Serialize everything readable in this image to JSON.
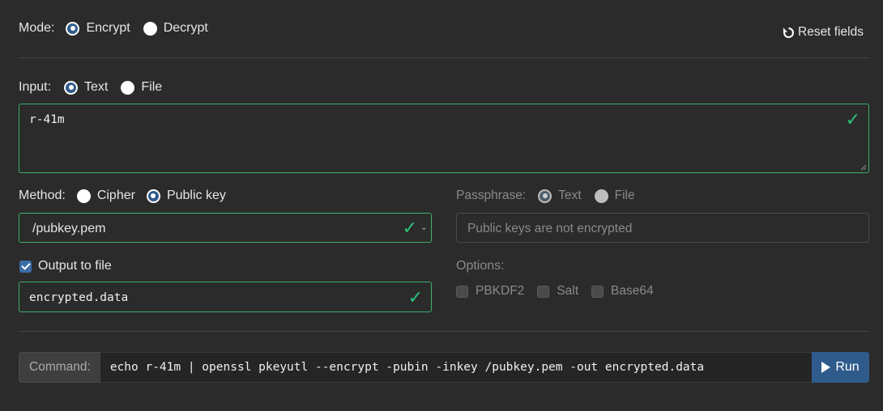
{
  "mode": {
    "label": "Mode:",
    "options": [
      "Encrypt",
      "Decrypt"
    ],
    "selected": "Encrypt"
  },
  "reset": {
    "label": "Reset fields",
    "icon": "reset-icon"
  },
  "input": {
    "label": "Input:",
    "options": [
      "Text",
      "File"
    ],
    "selected": "Text",
    "value": "r-41m"
  },
  "method": {
    "label": "Method:",
    "options": [
      "Cipher",
      "Public key"
    ],
    "selected": "Public key",
    "key_file": "/pubkey.pem"
  },
  "passphrase": {
    "label": "Passphrase:",
    "options": [
      "Text",
      "File"
    ],
    "selected": "Text",
    "placeholder": "Public keys are not encrypted"
  },
  "output": {
    "checkbox_label": "Output to file",
    "checked": true,
    "filename": "encrypted.data"
  },
  "options": {
    "label": "Options:",
    "items": [
      "PBKDF2",
      "Salt",
      "Base64"
    ]
  },
  "command": {
    "label": "Command:",
    "text": "echo r-41m | openssl pkeyutl --encrypt -pubin -inkey /pubkey.pem -out encrypted.data",
    "run_label": "Run"
  },
  "colors": {
    "accent": "#2f5b8c",
    "valid": "#2ec27e",
    "background": "#2b2b2b"
  }
}
